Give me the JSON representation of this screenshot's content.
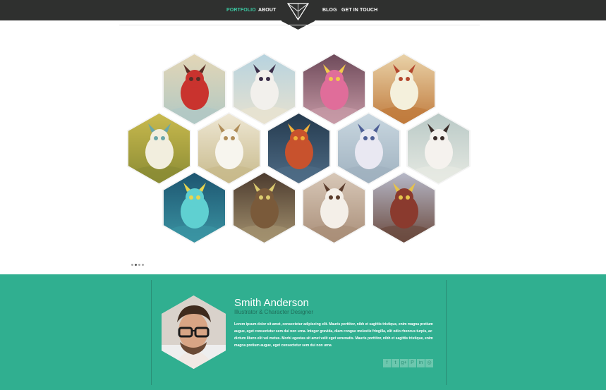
{
  "nav": {
    "left": [
      "PORTFOLIO",
      "ABOUT"
    ],
    "right": [
      "BLOG",
      "GET IN TOUCH"
    ],
    "active": "PORTFOLIO",
    "accent": "#3cc9a3"
  },
  "portfolio": {
    "items": [
      {
        "name": "red-horned-monster"
      },
      {
        "name": "sheep-robot"
      },
      {
        "name": "pink-cyclops"
      },
      {
        "name": "white-owl-monster"
      },
      {
        "name": "sleeping-yellow-creature"
      },
      {
        "name": "white-stag"
      },
      {
        "name": "red-tentacle-monster"
      },
      {
        "name": "white-yeti-pair"
      },
      {
        "name": "yeti-hood"
      },
      {
        "name": "jellyfish"
      },
      {
        "name": "tiki-mask-tower"
      },
      {
        "name": "white-dragon"
      },
      {
        "name": "mountain-creature"
      }
    ],
    "pager_count": 4
  },
  "bio": {
    "name": "Smith Anderson",
    "role": "Illustrator & Character Designer",
    "text": "Lorem ipsum dolor sit amet, consectetur adipiscing elit. Mauris porttitor, nibh et sagittis tristique, enim magna pretium augue, eget consectetur sem dui non urna. Integer gravida, diam congue molestie fringilla, elit odio rhoncus turpis, ac dictum libero elit vel metus. Morbi egestas sit amet velit eget venenatis. Mauris porttitor, nibh et sagittis tristique, enim magna pretium augue, eget consectetur sem dui non urna",
    "band_color": "#30af90",
    "social": [
      "facebook-icon",
      "twitter-icon",
      "google-plus-icon",
      "pinterest-icon",
      "linkedin-icon",
      "dribbble-icon"
    ],
    "social_glyphs": [
      "f",
      "t",
      "g+",
      "P",
      "in",
      "◎"
    ]
  }
}
